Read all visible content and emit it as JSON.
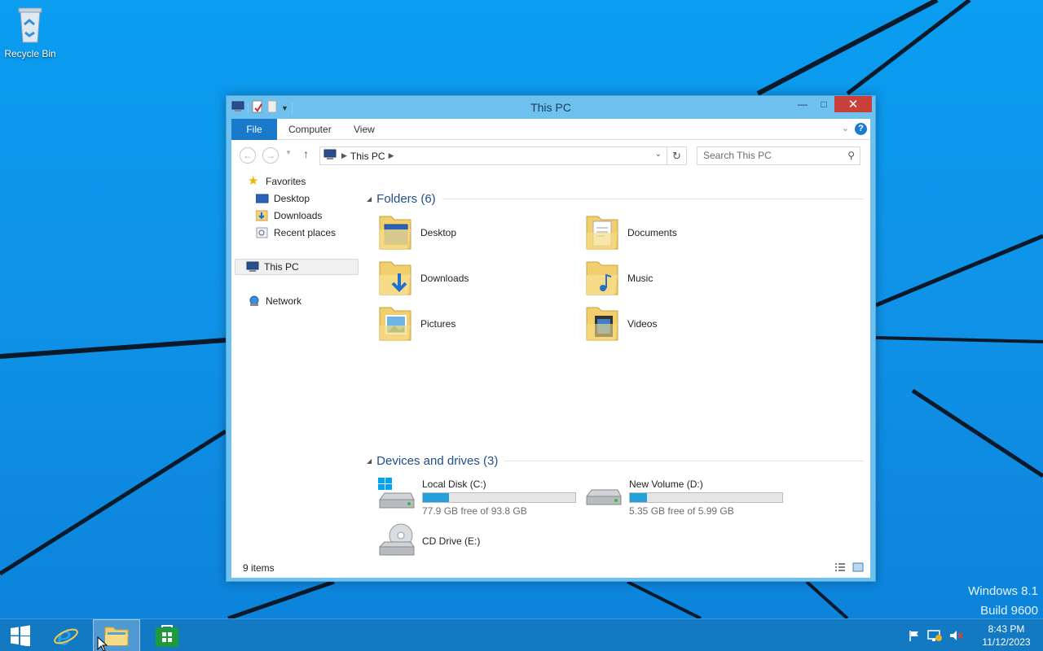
{
  "desktop": {
    "recycle_bin_label": "Recycle Bin",
    "watermark_line1": "Windows 8.1",
    "watermark_line2": "Build 9600"
  },
  "window": {
    "title": "This PC",
    "buttons": {
      "minimize": "—",
      "maximize": "□",
      "close": "✕"
    }
  },
  "ribbon": {
    "tabs": [
      {
        "label": "File",
        "active": true
      },
      {
        "label": "Computer"
      },
      {
        "label": "View"
      }
    ]
  },
  "address_bar": {
    "crumb": "This PC",
    "search_placeholder": "Search This PC"
  },
  "nav_pane": {
    "favorites": "Favorites",
    "items": [
      "Desktop",
      "Downloads",
      "Recent places"
    ],
    "this_pc": "This PC",
    "network": "Network"
  },
  "folders_group": {
    "title": "Folders (6)",
    "items": [
      "Desktop",
      "Documents",
      "Downloads",
      "Music",
      "Pictures",
      "Videos"
    ]
  },
  "drives_group": {
    "title": "Devices and drives (3)",
    "drives": [
      {
        "name": "Local Disk (C:)",
        "free": "77.9 GB free of 93.8 GB",
        "used_fraction": 0.17
      },
      {
        "name": "New Volume (D:)",
        "free": "5.35 GB free of 5.99 GB",
        "used_fraction": 0.11
      },
      {
        "name": "CD Drive (E:)"
      }
    ]
  },
  "status_bar": {
    "count": "9 items"
  },
  "taskbar": {
    "clock_time": "8:43 PM",
    "clock_date": "11/12/2023"
  },
  "colors": {
    "accent": "#1979ca",
    "drive_bar": "#26a0da",
    "close_button": "#c7413a"
  }
}
